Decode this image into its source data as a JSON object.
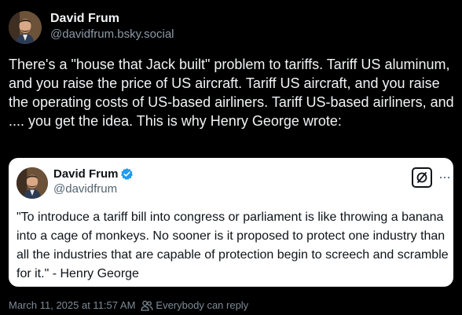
{
  "author": {
    "name": "David Frum",
    "handle": "@davidfrum.bsky.social"
  },
  "post_text": "There's a \"house that Jack built\" problem to tariffs. Tariff US aluminum, and you raise the price of US aircraft. Tariff US aircraft, and you raise the operating costs of US-based airliners. Tariff US-based airliners, and .... you get the idea. This is why Henry George wrote:",
  "embed": {
    "name": "David Frum",
    "handle": "@davidfrum",
    "quote": "\"To introduce a tariff bill into congress or parliament is like throwing a banana into a cage of monkeys. No sooner is it proposed to protect one industry than all the industries that are capable of protection begin to screech and scramble for it.\" - Henry George",
    "verified_color": "#1d9bf0"
  },
  "meta": {
    "timestamp": "March 11, 2025 at 11:57 AM",
    "reply_setting": "Everybody can reply"
  },
  "colors": {
    "background": "#000000",
    "text": "#f1f3f5",
    "muted": "#8d9aa8",
    "embed_background": "#ffffff"
  }
}
